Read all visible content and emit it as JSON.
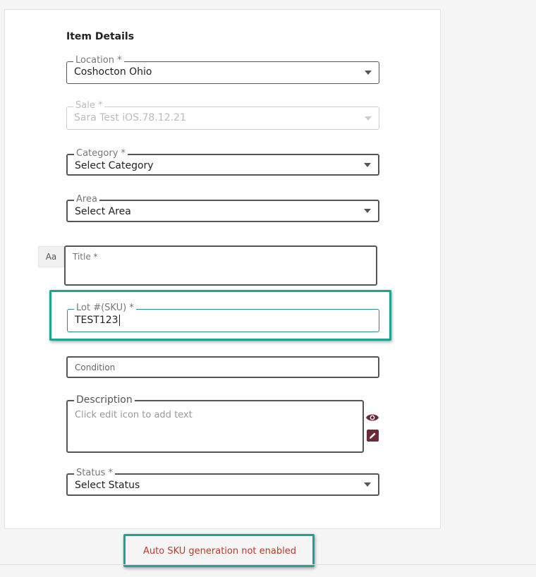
{
  "form": {
    "section_title": "Item Details",
    "location": {
      "label": "Location *",
      "value": "Coshocton Ohio"
    },
    "sale": {
      "label": "Sale *",
      "value": "Sara Test iOS.78.12.21",
      "disabled": true
    },
    "category": {
      "label": "Category *",
      "value": "Select Category"
    },
    "area": {
      "label": "Area",
      "value": "Select Area"
    },
    "title": {
      "label": "Title *",
      "value": "",
      "format_button": "Aa"
    },
    "lot": {
      "label": "Lot #(SKU) *",
      "value": "TEST123"
    },
    "condition": {
      "placeholder": "Condition"
    },
    "description": {
      "label": "Description",
      "placeholder": "Click edit icon to add text"
    },
    "status": {
      "label": "Status *",
      "value": "Select Status"
    }
  },
  "icons": {
    "preview": "eye-icon",
    "edit": "pencil-icon"
  },
  "messages": {
    "sku_error": "Auto SKU generation not enabled"
  },
  "colors": {
    "highlight": "#1aa58e",
    "error": "#c0392b",
    "icon": "#6b2a3a",
    "focus": "#2b8a91"
  }
}
